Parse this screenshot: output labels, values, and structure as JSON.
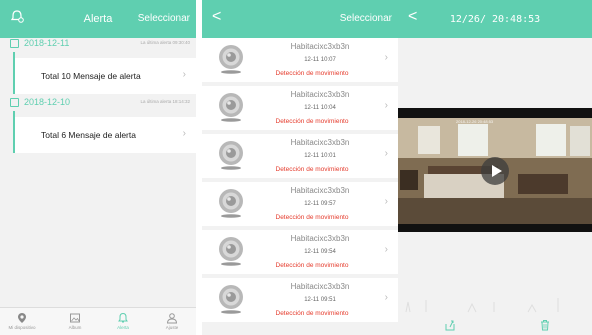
{
  "panel1": {
    "title": "Alerta",
    "right_action": "Seleccionar",
    "groups": [
      {
        "date": "2018-12-11",
        "last_alert": "La última alerta 09:30:40",
        "message": "Total 10 Mensaje de alerta"
      },
      {
        "date": "2018-12-10",
        "last_alert": "La última alerta 18:14:32",
        "message": "Total 6 Mensaje de alerta"
      }
    ],
    "tabs": [
      {
        "label": "Mi dispositivo",
        "icon": "location-pin-icon"
      },
      {
        "label": "Album",
        "icon": "album-icon"
      },
      {
        "label": "Alerta",
        "icon": "bell-icon"
      },
      {
        "label": "Ajuste",
        "icon": "person-icon"
      }
    ],
    "accent_color": "#5fcfb0"
  },
  "panel2": {
    "back": "<",
    "right_action": "Seleccionar",
    "items": [
      {
        "camera": "Habitacixc3xb3n",
        "time": "12-11 10:07",
        "event": "Detección de movimiento"
      },
      {
        "camera": "Habitacixc3xb3n",
        "time": "12-11 10:04",
        "event": "Detección de movimiento"
      },
      {
        "camera": "Habitacixc3xb3n",
        "time": "12-11 10:01",
        "event": "Detección de movimiento"
      },
      {
        "camera": "Habitacixc3xb3n",
        "time": "12-11 09:57",
        "event": "Detección de movimiento"
      },
      {
        "camera": "Habitacixc3xb3n",
        "time": "12-11 09:54",
        "event": "Detección de movimiento"
      },
      {
        "camera": "Habitacixc3xb3n",
        "time": "12-11 09:51",
        "event": "Detección de movimiento"
      }
    ],
    "event_color": "#e53b2c"
  },
  "panel3": {
    "back": "<",
    "title": "12/26/ 20:48:53",
    "video_timestamp": "2018-12-26 20:48:53",
    "actions": [
      {
        "icon": "share-icon"
      },
      {
        "icon": "trash-icon"
      }
    ]
  }
}
